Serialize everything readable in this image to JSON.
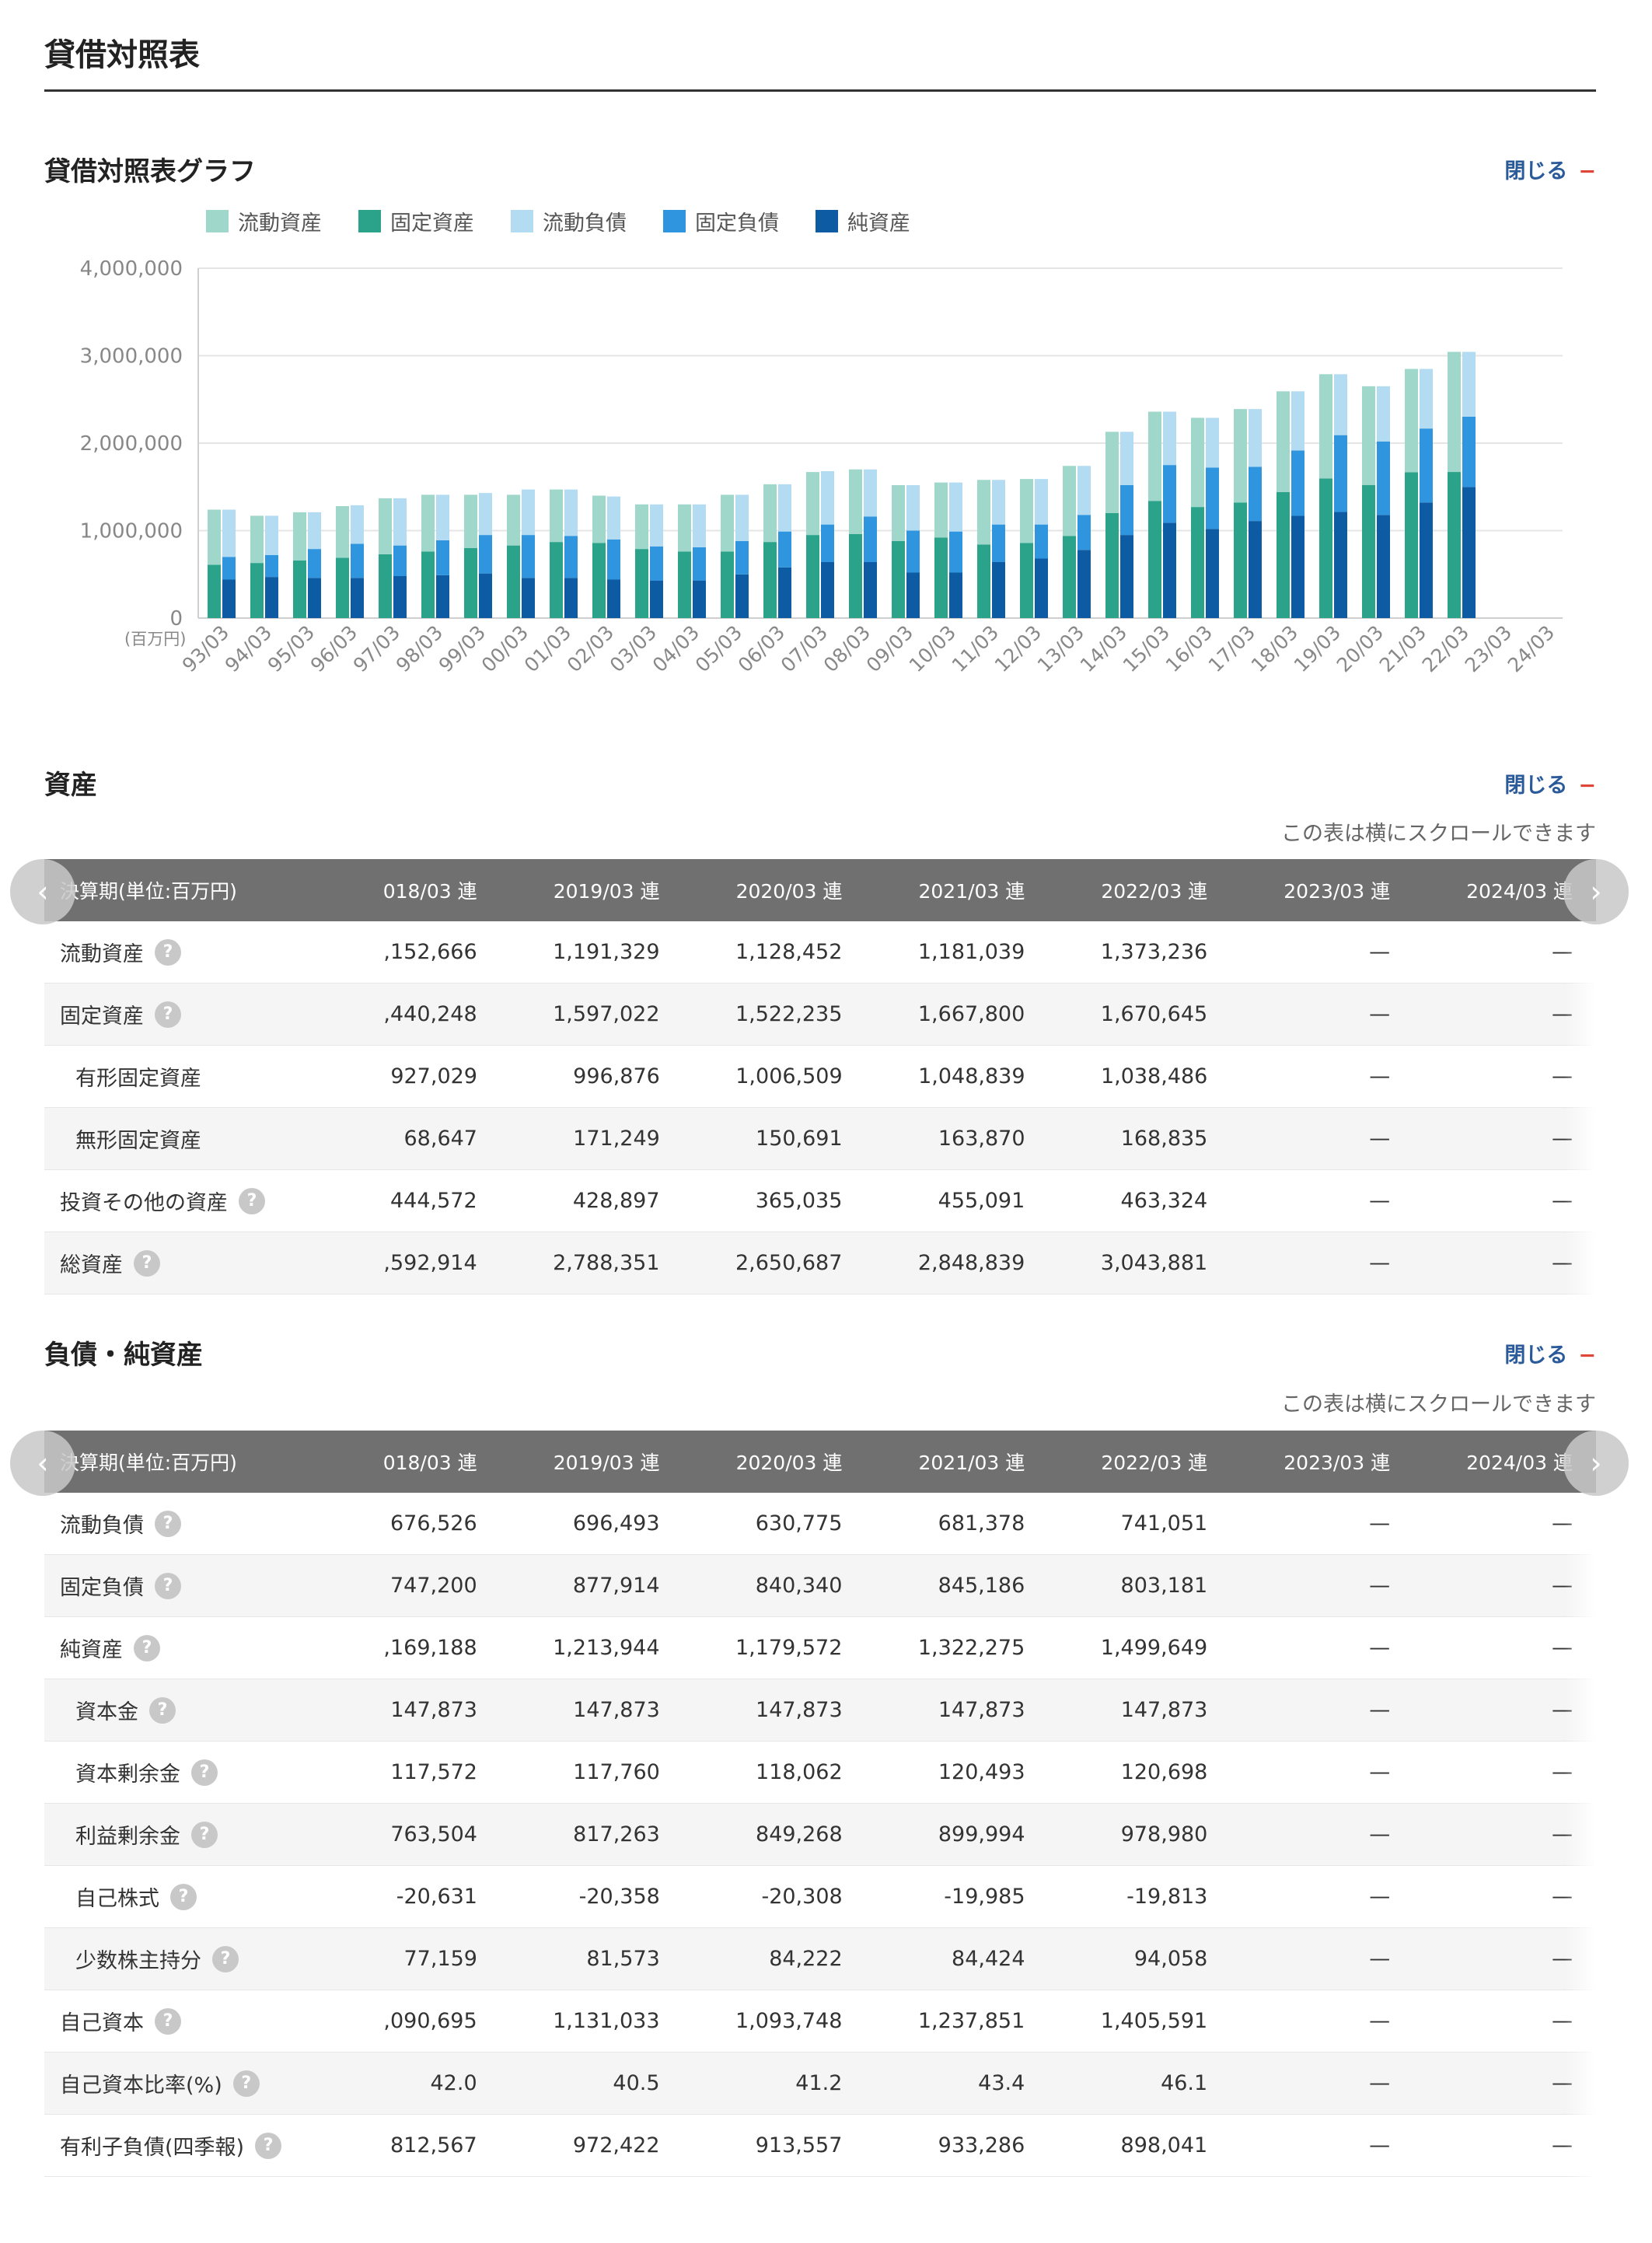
{
  "page": {
    "title": "貸借対照表"
  },
  "chart_section": {
    "title": "貸借対照表グラフ",
    "close_label": "閉じる",
    "close_icon": "−"
  },
  "chart_data": {
    "type": "bar",
    "unit_label": "(百万円)",
    "ylim": [
      0,
      4000000
    ],
    "y_ticks": [
      "0",
      "1,000,000",
      "2,000,000",
      "3,000,000",
      "4,000,000"
    ],
    "categories": [
      "93/03",
      "94/03",
      "95/03",
      "96/03",
      "97/03",
      "98/03",
      "99/03",
      "00/03",
      "01/03",
      "02/03",
      "03/03",
      "04/03",
      "05/03",
      "06/03",
      "07/03",
      "08/03",
      "09/03",
      "10/03",
      "11/03",
      "12/03",
      "13/03",
      "14/03",
      "15/03",
      "16/03",
      "17/03",
      "18/03",
      "19/03",
      "20/03",
      "21/03",
      "22/03",
      "23/03",
      "24/03"
    ],
    "groups": [
      {
        "name": "資産",
        "series": [
          {
            "name": "固定資産",
            "color": "#2aa38a",
            "values": [
              610000,
              630000,
              660000,
              690000,
              730000,
              760000,
              800000,
              830000,
              870000,
              860000,
              790000,
              760000,
              760000,
              870000,
              950000,
              960000,
              880000,
              920000,
              840000,
              860000,
              940000,
              1200000,
              1340000,
              1270000,
              1320000,
              1440000,
              1597022,
              1522235,
              1667800,
              1670645,
              null,
              null
            ]
          },
          {
            "name": "流動資産",
            "color": "#9fd8cb",
            "values": [
              630000,
              540000,
              550000,
              590000,
              640000,
              650000,
              610000,
              580000,
              600000,
              540000,
              510000,
              540000,
              650000,
              660000,
              720000,
              740000,
              640000,
              630000,
              740000,
              730000,
              800000,
              930000,
              1020000,
              1020000,
              1070000,
              1152666,
              1191329,
              1128452,
              1181039,
              1373236,
              null,
              null
            ]
          }
        ]
      },
      {
        "name": "負債・純資産",
        "series": [
          {
            "name": "純資産",
            "color": "#0d5ba3",
            "values": [
              440000,
              470000,
              460000,
              460000,
              480000,
              490000,
              510000,
              460000,
              460000,
              440000,
              430000,
              430000,
              500000,
              580000,
              640000,
              640000,
              520000,
              520000,
              640000,
              680000,
              780000,
              950000,
              1090000,
              1020000,
              1110000,
              1169188,
              1213944,
              1179572,
              1322275,
              1499649,
              null,
              null
            ]
          },
          {
            "name": "固定負債",
            "color": "#2f95de",
            "values": [
              260000,
              250000,
              330000,
              390000,
              350000,
              400000,
              440000,
              490000,
              480000,
              460000,
              390000,
              380000,
              380000,
              410000,
              430000,
              520000,
              480000,
              470000,
              430000,
              390000,
              400000,
              570000,
              660000,
              700000,
              620000,
              747200,
              877914,
              840340,
              845186,
              803181,
              null,
              null
            ]
          },
          {
            "name": "流動負債",
            "color": "#b3dcf2",
            "values": [
              540000,
              450000,
              420000,
              440000,
              540000,
              520000,
              480000,
              520000,
              530000,
              490000,
              480000,
              490000,
              530000,
              540000,
              610000,
              540000,
              520000,
              560000,
              510000,
              520000,
              560000,
              610000,
              610000,
              570000,
              660000,
              676526,
              696493,
              630775,
              681378,
              741051,
              null,
              null
            ]
          }
        ]
      }
    ],
    "legend": [
      {
        "label": "流動資産",
        "color": "#9fd8cb"
      },
      {
        "label": "固定資産",
        "color": "#2aa38a"
      },
      {
        "label": "流動負債",
        "color": "#b3dcf2"
      },
      {
        "label": "固定負債",
        "color": "#2f95de"
      },
      {
        "label": "純資産",
        "color": "#0d5ba3"
      }
    ]
  },
  "assets": {
    "title": "資産",
    "close_label": "閉じる",
    "close_icon": "−",
    "scroll_note": "この表は横にスクロールできます",
    "header_label": "決算期(単位:百万円)",
    "columns": [
      "018/03 連",
      "2019/03 連",
      "2020/03 連",
      "2021/03 連",
      "2022/03 連",
      "2023/03 連",
      "2024/03 連"
    ],
    "rows": [
      {
        "label": "流動資産",
        "help": true,
        "indent": false,
        "values": [
          ",152,666",
          "1,191,329",
          "1,128,452",
          "1,181,039",
          "1,373,236",
          "—",
          "—"
        ]
      },
      {
        "label": "固定資産",
        "help": true,
        "indent": false,
        "values": [
          ",440,248",
          "1,597,022",
          "1,522,235",
          "1,667,800",
          "1,670,645",
          "—",
          "—"
        ]
      },
      {
        "label": "有形固定資産",
        "help": false,
        "indent": true,
        "values": [
          "927,029",
          "996,876",
          "1,006,509",
          "1,048,839",
          "1,038,486",
          "—",
          "—"
        ]
      },
      {
        "label": "無形固定資産",
        "help": false,
        "indent": true,
        "values": [
          "68,647",
          "171,249",
          "150,691",
          "163,870",
          "168,835",
          "—",
          "—"
        ]
      },
      {
        "label": "投資その他の資産",
        "help": true,
        "indent": false,
        "values": [
          "444,572",
          "428,897",
          "365,035",
          "455,091",
          "463,324",
          "—",
          "—"
        ]
      },
      {
        "label": "総資産",
        "help": true,
        "indent": false,
        "values": [
          ",592,914",
          "2,788,351",
          "2,650,687",
          "2,848,839",
          "3,043,881",
          "—",
          "—"
        ]
      }
    ]
  },
  "liabilities": {
    "title": "負債・純資産",
    "close_label": "閉じる",
    "close_icon": "−",
    "scroll_note": "この表は横にスクロールできます",
    "header_label": "決算期(単位:百万円)",
    "columns": [
      "018/03 連",
      "2019/03 連",
      "2020/03 連",
      "2021/03 連",
      "2022/03 連",
      "2023/03 連",
      "2024/03 連"
    ],
    "rows": [
      {
        "label": "流動負債",
        "help": true,
        "indent": false,
        "values": [
          "676,526",
          "696,493",
          "630,775",
          "681,378",
          "741,051",
          "—",
          "—"
        ]
      },
      {
        "label": "固定負債",
        "help": true,
        "indent": false,
        "values": [
          "747,200",
          "877,914",
          "840,340",
          "845,186",
          "803,181",
          "—",
          "—"
        ]
      },
      {
        "label": "純資産",
        "help": true,
        "indent": false,
        "values": [
          ",169,188",
          "1,213,944",
          "1,179,572",
          "1,322,275",
          "1,499,649",
          "—",
          "—"
        ]
      },
      {
        "label": "資本金",
        "help": true,
        "indent": true,
        "values": [
          "147,873",
          "147,873",
          "147,873",
          "147,873",
          "147,873",
          "—",
          "—"
        ]
      },
      {
        "label": "資本剰余金",
        "help": true,
        "indent": true,
        "values": [
          "117,572",
          "117,760",
          "118,062",
          "120,493",
          "120,698",
          "—",
          "—"
        ]
      },
      {
        "label": "利益剰余金",
        "help": true,
        "indent": true,
        "values": [
          "763,504",
          "817,263",
          "849,268",
          "899,994",
          "978,980",
          "—",
          "—"
        ]
      },
      {
        "label": "自己株式",
        "help": true,
        "indent": true,
        "values": [
          "-20,631",
          "-20,358",
          "-20,308",
          "-19,985",
          "-19,813",
          "—",
          "—"
        ]
      },
      {
        "label": "少数株主持分",
        "help": true,
        "indent": true,
        "values": [
          "77,159",
          "81,573",
          "84,222",
          "84,424",
          "94,058",
          "—",
          "—"
        ]
      },
      {
        "label": "自己資本",
        "help": true,
        "indent": false,
        "values": [
          ",090,695",
          "1,131,033",
          "1,093,748",
          "1,237,851",
          "1,405,591",
          "—",
          "—"
        ]
      },
      {
        "label": "自己資本比率(%)",
        "help": true,
        "indent": false,
        "values": [
          "42.0",
          "40.5",
          "41.2",
          "43.4",
          "46.1",
          "—",
          "—"
        ]
      },
      {
        "label": "有利子負債(四季報)",
        "help": true,
        "indent": false,
        "values": [
          "812,567",
          "972,422",
          "913,557",
          "933,286",
          "898,041",
          "—",
          "—"
        ]
      }
    ]
  },
  "ui": {
    "help_glyph": "?",
    "prev_glyph": "‹",
    "next_glyph": "›"
  }
}
